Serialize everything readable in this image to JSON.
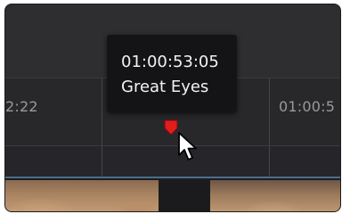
{
  "timeline": {
    "ruler": {
      "left_timecode": "2:22",
      "right_timecode": "01:00:5"
    },
    "marker": {
      "color": "#e11d1d",
      "tooltip": {
        "timecode": "01:00:53:05",
        "name": "Great Eyes"
      }
    },
    "cursor_icon": "arrow-pointer-icon",
    "track_accent_color": "#4a6f8a"
  }
}
